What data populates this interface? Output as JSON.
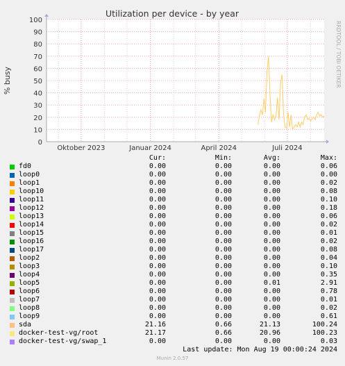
{
  "chart_data": {
    "type": "line",
    "title": "Utilization per device - by year",
    "ylabel": "% busy",
    "ylim": [
      0,
      100
    ],
    "yticks": [
      0,
      10,
      20,
      30,
      40,
      50,
      60,
      70,
      80,
      90,
      100
    ],
    "xrange": [
      "2023-08-16",
      "2024-08-19"
    ],
    "xticks": [
      {
        "date": "2023-10-01",
        "label": "Oktober 2023"
      },
      {
        "date": "2024-01-01",
        "label": "Januar 2024"
      },
      {
        "date": "2024-04-01",
        "label": "April 2024"
      },
      {
        "date": "2024-07-01",
        "label": "Juli 2024"
      }
    ],
    "grid": true,
    "side_label": "RRDTOOL / TOBI OETIKER",
    "series": [
      {
        "name": "sda",
        "color": "#ffcc66",
        "points": [
          [
            "2024-05-23",
            14
          ],
          [
            "2024-05-25",
            22
          ],
          [
            "2024-05-27",
            26
          ],
          [
            "2024-05-29",
            22
          ],
          [
            "2024-05-31",
            35
          ],
          [
            "2024-06-02",
            24
          ],
          [
            "2024-06-04",
            57
          ],
          [
            "2024-06-06",
            70
          ],
          [
            "2024-06-08",
            38
          ],
          [
            "2024-06-10",
            16
          ],
          [
            "2024-06-12",
            22
          ],
          [
            "2024-06-14",
            18
          ],
          [
            "2024-06-16",
            21
          ],
          [
            "2024-06-18",
            36
          ],
          [
            "2024-06-20",
            18
          ],
          [
            "2024-06-22",
            48
          ],
          [
            "2024-06-24",
            55
          ],
          [
            "2024-06-26",
            22
          ],
          [
            "2024-06-28",
            12
          ],
          [
            "2024-06-30",
            11
          ],
          [
            "2024-07-02",
            24
          ],
          [
            "2024-07-04",
            12
          ],
          [
            "2024-07-06",
            22
          ],
          [
            "2024-07-08",
            10
          ],
          [
            "2024-07-10",
            12
          ],
          [
            "2024-07-12",
            14
          ],
          [
            "2024-07-14",
            12
          ],
          [
            "2024-07-16",
            16
          ],
          [
            "2024-07-18",
            12
          ],
          [
            "2024-07-20",
            16
          ],
          [
            "2024-07-22",
            14
          ],
          [
            "2024-07-24",
            20
          ],
          [
            "2024-07-26",
            22
          ],
          [
            "2024-07-28",
            18
          ],
          [
            "2024-07-30",
            19
          ],
          [
            "2024-08-01",
            17
          ],
          [
            "2024-08-03",
            19
          ],
          [
            "2024-08-05",
            20
          ],
          [
            "2024-08-07",
            18
          ],
          [
            "2024-08-09",
            22
          ],
          [
            "2024-08-11",
            24
          ],
          [
            "2024-08-13",
            21
          ],
          [
            "2024-08-15",
            22
          ],
          [
            "2024-08-17",
            20
          ],
          [
            "2024-08-19",
            21
          ]
        ]
      }
    ]
  },
  "legend": {
    "headers": {
      "cur": "Cur:",
      "min": "Min:",
      "avg": "Avg:",
      "max": "Max:"
    },
    "rows": [
      {
        "name": "fd0",
        "color": "#00cc00",
        "cur": "0.00",
        "min": "0.00",
        "avg": "0.00",
        "max": "0.06"
      },
      {
        "name": "loop0",
        "color": "#0066b3",
        "cur": "0.00",
        "min": "0.00",
        "avg": "0.00",
        "max": "0.00"
      },
      {
        "name": "loop1",
        "color": "#ff8000",
        "cur": "0.00",
        "min": "0.00",
        "avg": "0.00",
        "max": "0.02"
      },
      {
        "name": "loop10",
        "color": "#ffcc00",
        "cur": "0.00",
        "min": "0.00",
        "avg": "0.00",
        "max": "0.08"
      },
      {
        "name": "loop11",
        "color": "#330099",
        "cur": "0.00",
        "min": "0.00",
        "avg": "0.00",
        "max": "0.10"
      },
      {
        "name": "loop12",
        "color": "#990099",
        "cur": "0.00",
        "min": "0.00",
        "avg": "0.00",
        "max": "0.18"
      },
      {
        "name": "loop13",
        "color": "#ccff00",
        "cur": "0.00",
        "min": "0.00",
        "avg": "0.00",
        "max": "0.06"
      },
      {
        "name": "loop14",
        "color": "#ff0000",
        "cur": "0.00",
        "min": "0.00",
        "avg": "0.00",
        "max": "0.02"
      },
      {
        "name": "loop15",
        "color": "#808080",
        "cur": "0.00",
        "min": "0.00",
        "avg": "0.00",
        "max": "0.01"
      },
      {
        "name": "loop16",
        "color": "#008f00",
        "cur": "0.00",
        "min": "0.00",
        "avg": "0.00",
        "max": "0.02"
      },
      {
        "name": "loop17",
        "color": "#00487d",
        "cur": "0.00",
        "min": "0.00",
        "avg": "0.00",
        "max": "0.08"
      },
      {
        "name": "loop2",
        "color": "#b35a00",
        "cur": "0.00",
        "min": "0.00",
        "avg": "0.00",
        "max": "0.04"
      },
      {
        "name": "loop3",
        "color": "#b38f00",
        "cur": "0.00",
        "min": "0.00",
        "avg": "0.00",
        "max": "0.10"
      },
      {
        "name": "loop4",
        "color": "#6b006b",
        "cur": "0.00",
        "min": "0.00",
        "avg": "0.00",
        "max": "0.35"
      },
      {
        "name": "loop5",
        "color": "#8fb300",
        "cur": "0.00",
        "min": "0.00",
        "avg": "0.01",
        "max": "2.91"
      },
      {
        "name": "loop6",
        "color": "#b30000",
        "cur": "0.00",
        "min": "0.00",
        "avg": "0.00",
        "max": "0.78"
      },
      {
        "name": "loop7",
        "color": "#bebebe",
        "cur": "0.00",
        "min": "0.00",
        "avg": "0.00",
        "max": "0.01"
      },
      {
        "name": "loop8",
        "color": "#80ff80",
        "cur": "0.00",
        "min": "0.00",
        "avg": "0.00",
        "max": "0.02"
      },
      {
        "name": "loop9",
        "color": "#80c9ff",
        "cur": "0.00",
        "min": "0.00",
        "avg": "0.00",
        "max": "0.61"
      },
      {
        "name": "sda",
        "color": "#ffc080",
        "cur": "21.16",
        "min": "0.66",
        "avg": "21.13",
        "max": "100.24"
      },
      {
        "name": "docker-test-vg/root",
        "color": "#ffe680",
        "cur": "21.17",
        "min": "0.66",
        "avg": "20.96",
        "max": "100.23"
      },
      {
        "name": "docker-test-vg/swap_1",
        "color": "#aa80ff",
        "cur": "0.00",
        "min": "0.00",
        "avg": "0.00",
        "max": "0.03"
      }
    ],
    "last_update": "Last update: Mon Aug 19 00:00:24 2024"
  },
  "footer": "Munin 2.0.57"
}
